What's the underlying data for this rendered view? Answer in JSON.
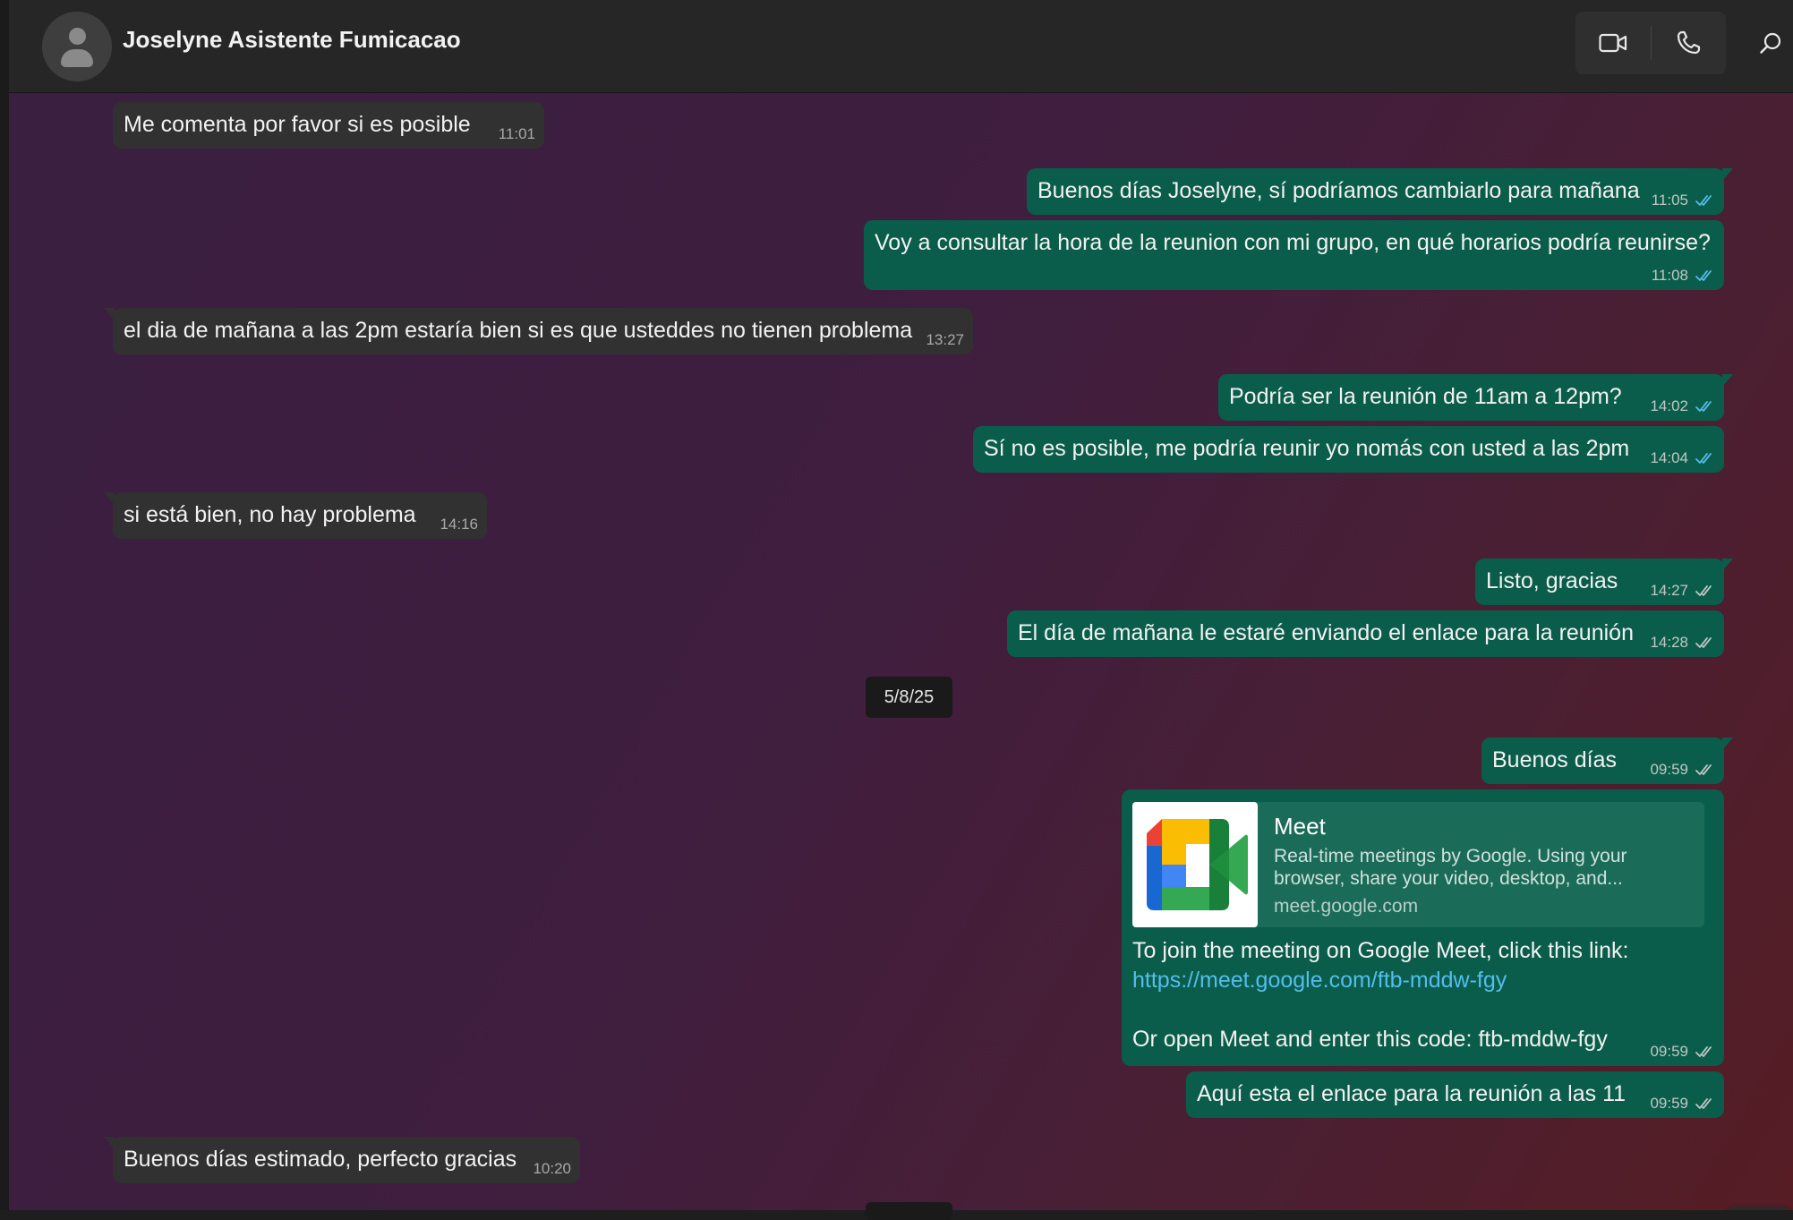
{
  "header": {
    "contact_name": "Joselyne Asistente Fumicacao"
  },
  "icons": {
    "video": "video-call-icon",
    "voice": "phone-icon",
    "search": "search-icon",
    "scroll": "arrow-down-icon",
    "avatar": "person-icon"
  },
  "colors": {
    "incoming_bubble": "#313131",
    "outgoing_bubble": "#0b5d4b",
    "read_check": "#53bdeb",
    "delivered_check": "#bfc7c4",
    "link": "#53bdeb"
  },
  "messages": [
    {
      "direction": "in",
      "text": "Me comenta por favor si es posible",
      "time": "11:01"
    },
    {
      "direction": "out",
      "text": "Buenos días Joselyne, sí podríamos cambiarlo para mañana",
      "time": "11:05",
      "status": "read"
    },
    {
      "direction": "out",
      "text": "Voy a consultar la hora de la reunion con mi grupo, en qué horarios podría reunirse?",
      "time": "11:08",
      "status": "read"
    },
    {
      "direction": "in",
      "text": "el dia de mañana a las 2pm estaría bien si es que usteddes no tienen problema",
      "time": "13:27"
    },
    {
      "direction": "out",
      "text": "Podría ser la reunión de 11am a 12pm?",
      "time": "14:02",
      "status": "read"
    },
    {
      "direction": "out",
      "text": "Sí no es posible, me podría reunir yo nomás con usted a las 2pm",
      "time": "14:04",
      "status": "read"
    },
    {
      "direction": "in",
      "text": "si está bien, no hay problema",
      "time": "14:16"
    },
    {
      "direction": "out",
      "text": "Listo, gracias",
      "time": "14:27",
      "status": "delivered"
    },
    {
      "direction": "out",
      "text": "El día de mañana le estaré enviando el enlace para la reunión",
      "time": "14:28",
      "status": "delivered"
    },
    {
      "direction": "out",
      "text": "Buenos días",
      "time": "09:59",
      "status": "delivered"
    },
    {
      "direction": "out",
      "type": "link",
      "preview": {
        "title": "Meet",
        "description": "Real-time meetings by Google. Using your browser, share your video, desktop, and...",
        "domain": "meet.google.com"
      },
      "line1": "To join the meeting on Google Meet, click this link:",
      "link": "https://meet.google.com/ftb-mddw-fgy",
      "line2": "Or open Meet and enter this code: ftb-mddw-fgy",
      "time": "09:59",
      "status": "delivered"
    },
    {
      "direction": "out",
      "text": "Aquí esta el enlace para la reunión a las 11",
      "time": "09:59",
      "status": "delivered"
    },
    {
      "direction": "in",
      "text": "Buenos días estimado, perfecto gracias",
      "time": "10:20"
    }
  ],
  "date_separator": "5/8/25"
}
